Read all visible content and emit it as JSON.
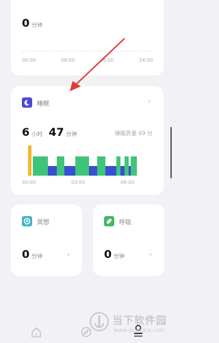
{
  "activity": {
    "value": "0",
    "unit": "分钟",
    "ticks": [
      "00:00",
      "08:00",
      "16:00",
      "24:00"
    ]
  },
  "sleep": {
    "title": "睡眠",
    "hours": "6",
    "hours_unit": "小时",
    "minutes": "47",
    "minutes_unit": "分钟",
    "quality": "睡眠质量 69 分",
    "ticks": [
      "00:00",
      "03:00",
      "06:00"
    ],
    "icon": "moon-icon"
  },
  "meditate": {
    "title": "冥想",
    "value": "0",
    "unit": "分钟",
    "icon": "meditation-icon"
  },
  "breath": {
    "title": "呼吸",
    "value": "0",
    "unit": "分钟",
    "icon": "leaf-icon"
  },
  "colors": {
    "awake": "#f6b52c",
    "light": "#3fc57a",
    "deep": "#3a4ed0",
    "arrow": "#e53935"
  },
  "watermark": {
    "title": "当下软件园",
    "subtitle": "www.downxia.com"
  }
}
